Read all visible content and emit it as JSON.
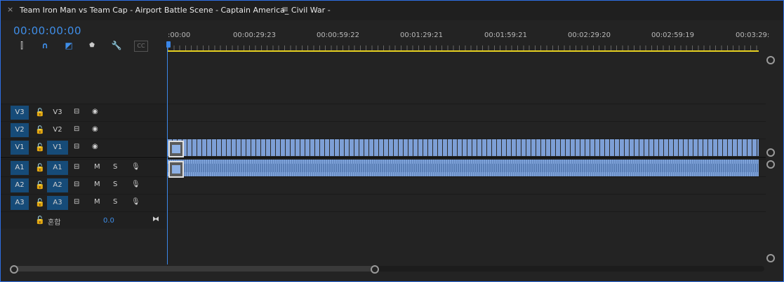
{
  "tab": {
    "close_icon": "×",
    "title": "Team Iron Man vs Team Cap - Airport Battle Scene - Captain America_ Civil War -",
    "menu_icon": "≡"
  },
  "timecode": "00:00:00:00",
  "toolbar": {
    "tools": [
      "insert-track-icon",
      "snap-magnet-icon",
      "linked-selection-icon",
      "add-marker-icon",
      "wrench-settings-icon",
      "captions-icon"
    ],
    "glyphs": [
      "⫿",
      "∩",
      "◩",
      "⬟",
      "🔧",
      "CC"
    ]
  },
  "ruler": {
    "labels": [
      ":00:00",
      "00:00:29:23",
      "00:00:59:22",
      "00:01:29:21",
      "00:01:59:21",
      "00:02:29:20",
      "00:02:59:19",
      "00:03:29:"
    ]
  },
  "tracks": {
    "video": [
      {
        "target": "V3",
        "name": "V3"
      },
      {
        "target": "V2",
        "name": "V2"
      },
      {
        "target": "V1",
        "name": "V1"
      }
    ],
    "audio": [
      {
        "target": "A1",
        "name": "A1",
        "m": "M",
        "s": "S"
      },
      {
        "target": "A2",
        "name": "A2",
        "m": "M",
        "s": "S"
      },
      {
        "target": "A3",
        "name": "A3",
        "m": "M",
        "s": "S"
      }
    ],
    "mix": {
      "label": "혼합",
      "value": "0.0"
    }
  },
  "colors": {
    "accent": "#3f8ee8",
    "clip_video": "#7d9fd6",
    "clip_audio": "#8db0e4",
    "work_area": "#e6d020"
  }
}
